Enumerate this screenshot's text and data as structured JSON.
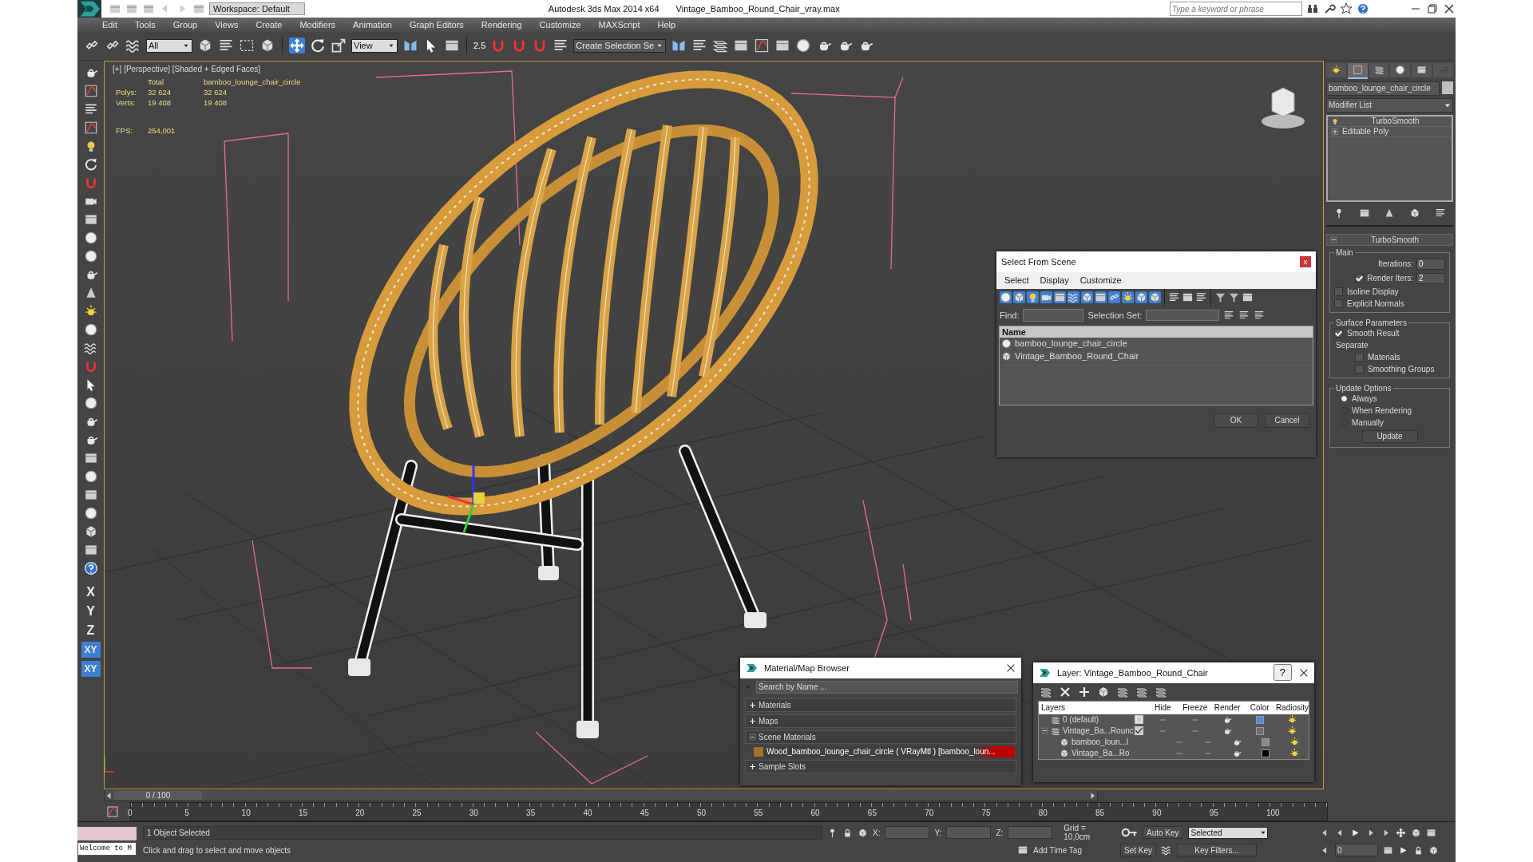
{
  "title_bar": {
    "workspace": "Workspace: Default",
    "app": "Autodesk 3ds Max  2014 x64",
    "file": "Vintage_Bamboo_Round_Chair_vray.max",
    "search": {
      "placeholder": "Type a keyword or phrase"
    }
  },
  "menu": [
    "Edit",
    "Tools",
    "Group",
    "Views",
    "Create",
    "Modifiers",
    "Animation",
    "Graph Editors",
    "Rendering",
    "Customize",
    "MAXScript",
    "Help"
  ],
  "main_toolbar": {
    "selection_filter": "All",
    "reference_coord": "View",
    "snap_label": "2.5",
    "named_selection": "Create Selection Se",
    "move_selected": true
  },
  "left_toolbar": {
    "axis_buttons": [
      {
        "label": "X",
        "selected": false
      },
      {
        "label": "Y",
        "selected": false
      },
      {
        "label": "Z",
        "selected": false
      },
      {
        "label": "XY",
        "selected": true
      },
      {
        "label": "XY",
        "selected": true
      }
    ]
  },
  "viewport": {
    "label": "[+] [Perspective] [Shaded + Edged Faces]",
    "stats": {
      "header": [
        "Total",
        "bamboo_lounge_chair_circle"
      ],
      "rows": [
        {
          "label": "Polys:",
          "values": [
            "32 624",
            "32 624"
          ]
        },
        {
          "label": "Verts:",
          "values": [
            "19 408",
            "19 408"
          ]
        }
      ],
      "fps_label": "FPS:",
      "fps": "254,001"
    }
  },
  "command_panel": {
    "tabs": [
      {
        "selected": false
      },
      {
        "selected": true
      },
      {
        "selected": false
      },
      {
        "selected": false
      },
      {
        "selected": false
      },
      {
        "selected": false
      }
    ],
    "object_name": "bamboo_lounge_chair_circle",
    "modifier_list": "Modifier List",
    "stack": [
      {
        "name": "TurboSmooth",
        "kind": "modifier",
        "selected": false
      },
      {
        "name": "Editable Poly",
        "kind": "base",
        "selected": false
      }
    ],
    "rollout": {
      "title": "TurboSmooth",
      "expanded": true,
      "main_label": "Main",
      "iterations_label": "Iterations:",
      "iterations": "0",
      "render_iters_label": "Render Iters:",
      "render_iters": "2",
      "render_iters_checked": true,
      "main_checks": [
        {
          "label": "Isoline Display",
          "checked": false
        },
        {
          "label": "Explicit Normals",
          "checked": false
        }
      ],
      "surface_label": "Surface Parameters",
      "smooth_result": {
        "label": "Smooth Result",
        "checked": true
      },
      "separate_label": "Separate",
      "separate_checks": [
        {
          "label": "Materials",
          "checked": false
        },
        {
          "label": "Smoothing Groups",
          "checked": false
        }
      ],
      "update_label": "Update Options",
      "update_options": [
        {
          "label": "Always",
          "selected": true
        },
        {
          "label": "When Rendering",
          "selected": false
        },
        {
          "label": "Manually",
          "selected": false
        }
      ],
      "update_button": "Update"
    }
  },
  "select_from_scene": {
    "title": "Select From Scene",
    "close": "x",
    "menu": [
      "Select",
      "Display",
      "Customize"
    ],
    "find_label": "Find:",
    "selection_set_label": "Selection Set:",
    "column": "Name",
    "rows": [
      {
        "name": "bamboo_lounge_chair_circle",
        "kind": "geometry"
      },
      {
        "name": "Vintage_Bamboo_Round_Chair",
        "kind": "group"
      }
    ],
    "ok": "OK",
    "cancel": "Cancel"
  },
  "material_browser": {
    "title": "Material/Map Browser",
    "search": {
      "placeholder": "Search by Name ..."
    },
    "sections": [
      {
        "label": "Materials",
        "expanded": false
      },
      {
        "label": "Maps",
        "expanded": false
      },
      {
        "label": "Scene Materials",
        "expanded": true,
        "items": [
          "Wood_bamboo_lounge_chair_circle ( VRayMtl ) [bamboo_loun..."
        ]
      },
      {
        "label": "Sample Slots",
        "expanded": false
      }
    ]
  },
  "layer_explorer": {
    "title": "Layer: Vintage_Bamboo_Round_Chair",
    "help": "?",
    "columns": [
      "Layers",
      "Hide",
      "Freeze",
      "Render",
      "Color",
      "Radiosity"
    ],
    "layers": [
      {
        "name": "0 (default)",
        "current": false,
        "color": "#4a8ee6"
      },
      {
        "name": "Vintage_Ba...Rounc",
        "current": true,
        "expanded": true,
        "color": "#6e6e6e",
        "children": [
          {
            "name": "bamboo_loun...l",
            "color": "#8a8a8a"
          },
          {
            "name": "Vintage_Ba...Ro",
            "color": "#000000"
          }
        ]
      }
    ]
  },
  "timeline": {
    "frame": "0 / 100",
    "level": 0,
    "ticks": [
      "0",
      "5",
      "10",
      "15",
      "20",
      "25",
      "30",
      "35",
      "40",
      "45",
      "50",
      "55",
      "60",
      "65",
      "70",
      "75",
      "80",
      "85",
      "90",
      "95",
      "100"
    ]
  },
  "status_bar": {
    "listener": "Welcome to M",
    "selection": "1 Object Selected",
    "prompt": "Click and drag to select and move objects",
    "coords": [
      "X:",
      "Y:",
      "Z:"
    ],
    "grid": "Grid = 10,0cm",
    "add_time_tag": "Add Time Tag",
    "auto_key": "Auto Key",
    "set_key": "Set Key",
    "key_mode": "Selected",
    "key_filters": "Key Filters...",
    "current_frame": "0"
  }
}
